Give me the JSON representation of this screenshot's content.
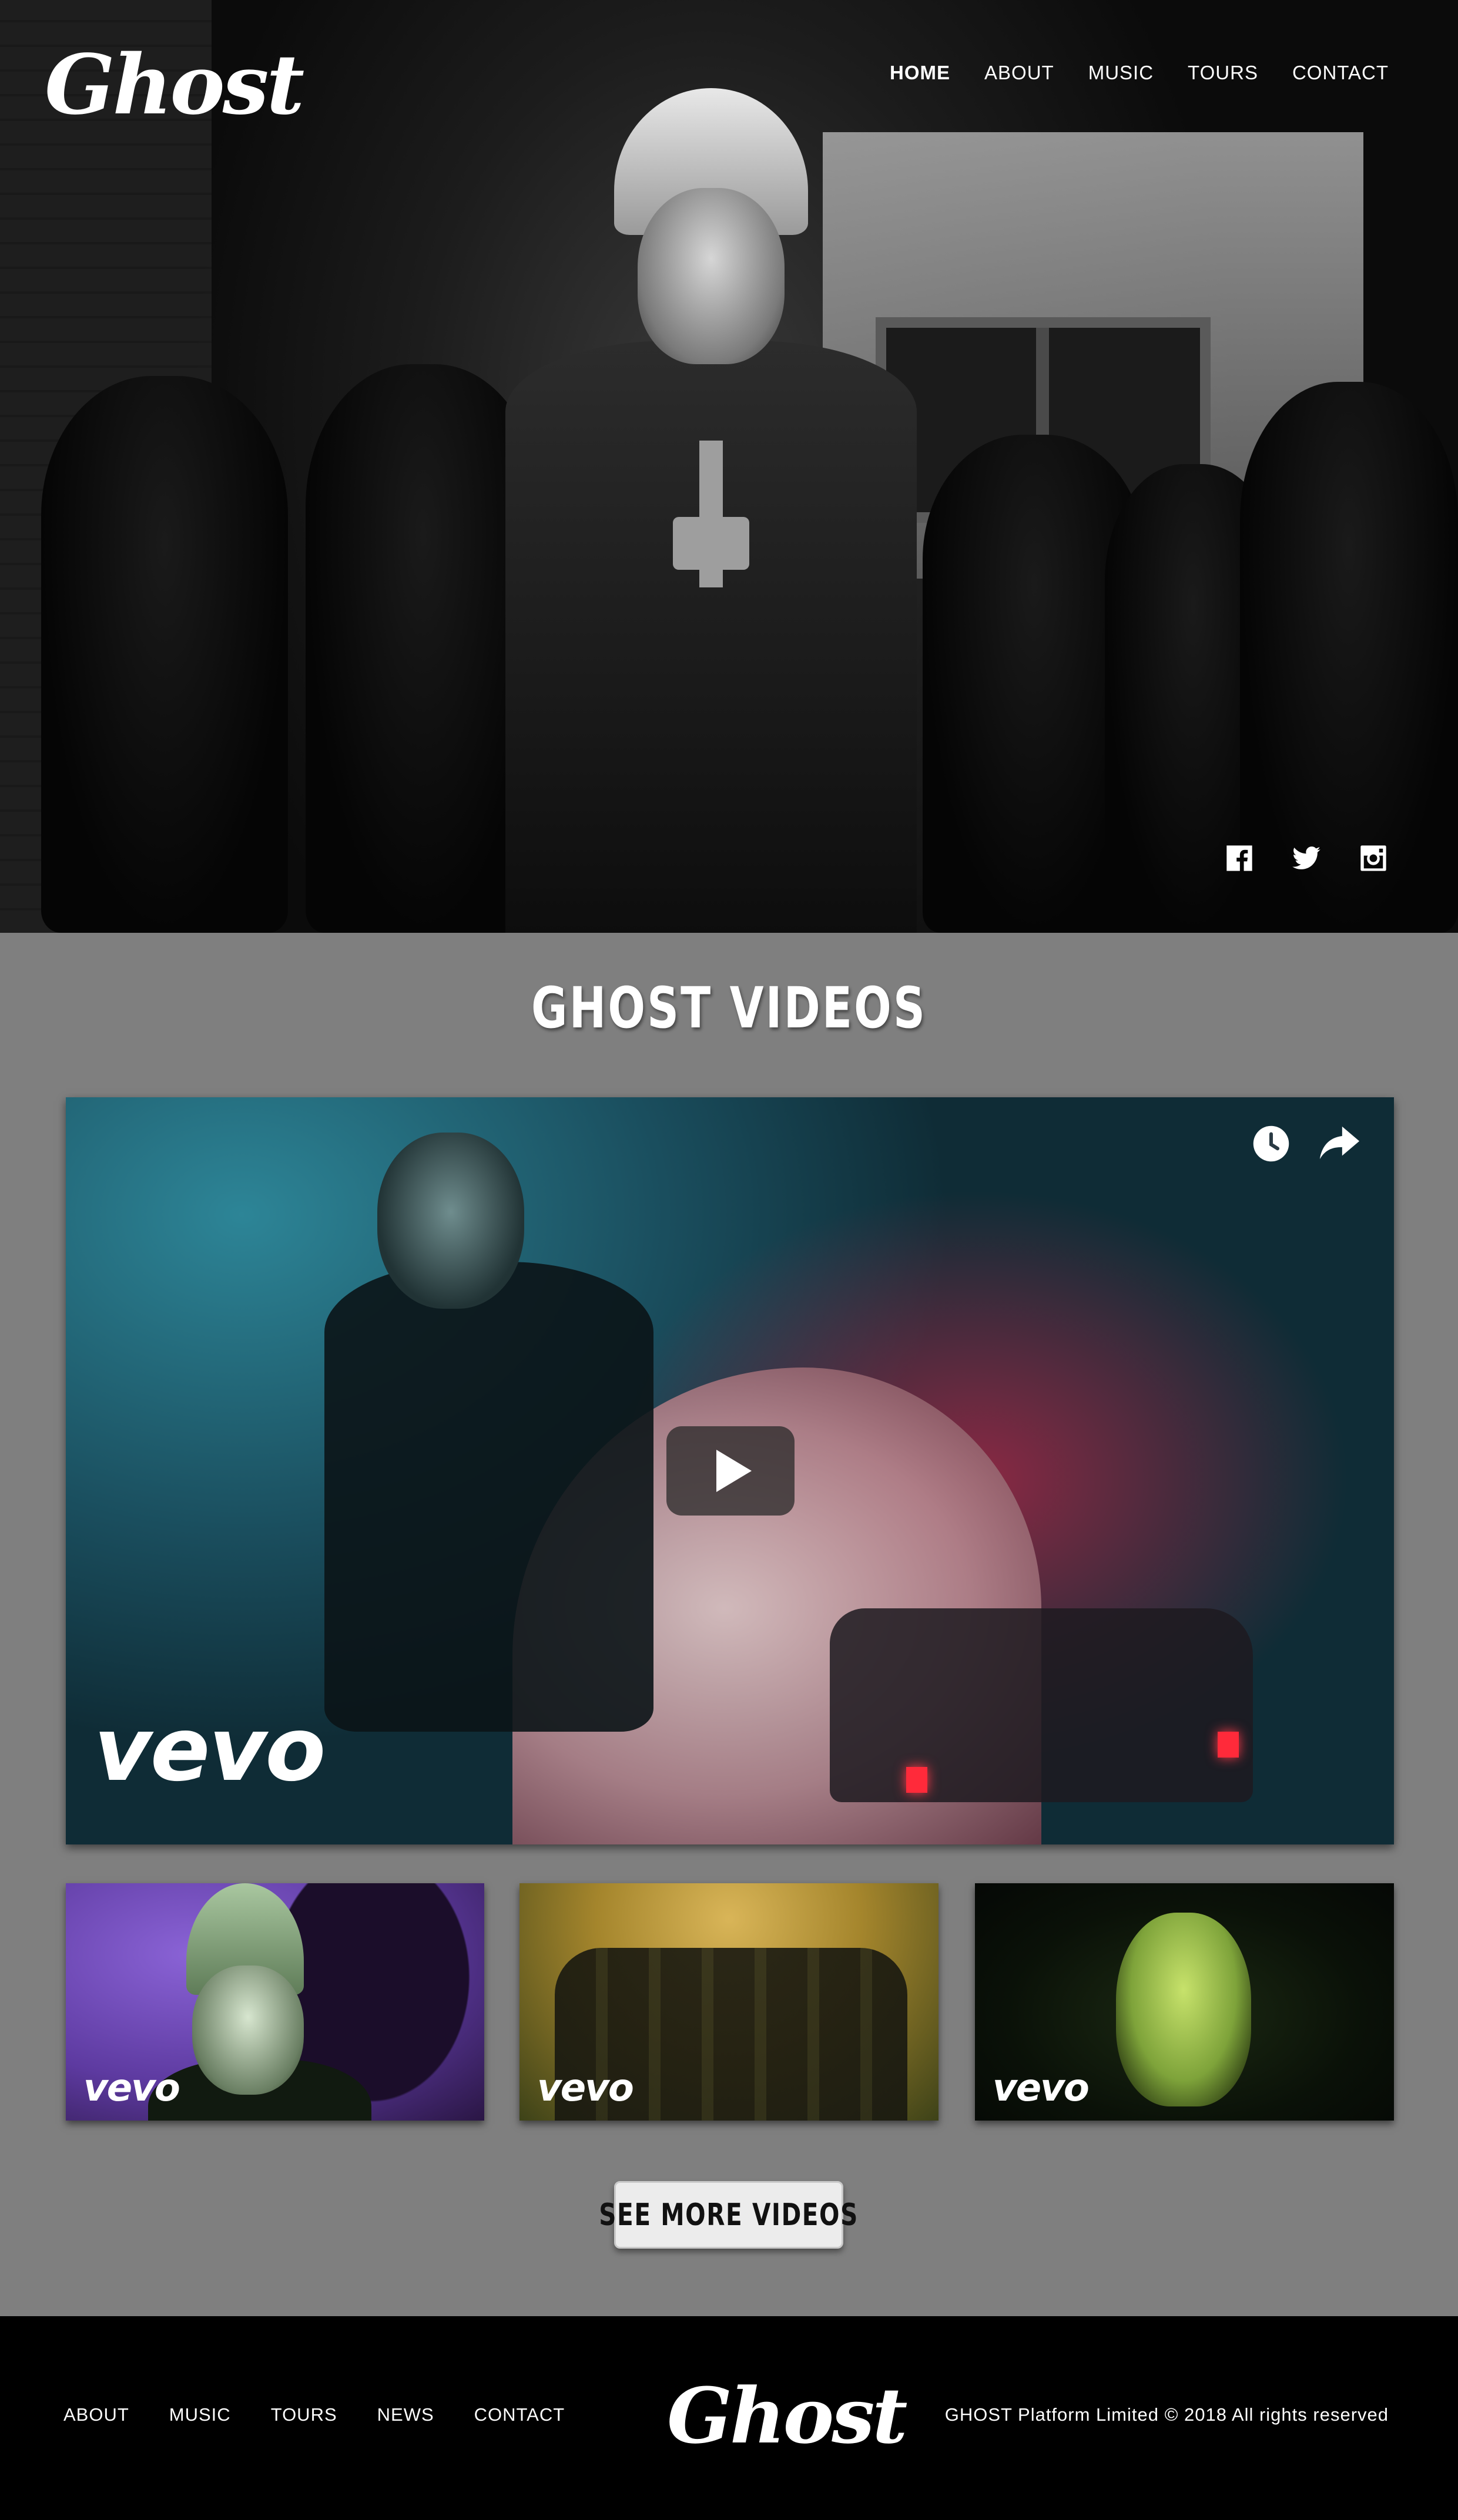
{
  "header": {
    "logo_text": "Ghost",
    "nav": [
      {
        "label": "HOME",
        "active": true
      },
      {
        "label": "ABOUT",
        "active": false
      },
      {
        "label": "MUSIC",
        "active": false
      },
      {
        "label": "TOURS",
        "active": false
      },
      {
        "label": "CONTACT",
        "active": false
      }
    ],
    "social_icons": [
      "facebook-icon",
      "twitter-icon",
      "instagram-icon"
    ]
  },
  "videos": {
    "title": "GHOST VIDEOS",
    "main_video": {
      "watermark": "vevo",
      "icons": [
        "clock-icon",
        "share-icon",
        "play-icon"
      ]
    },
    "thumbnails": [
      {
        "watermark": "vevo"
      },
      {
        "watermark": "vevo"
      },
      {
        "watermark": "vevo"
      }
    ],
    "see_more_label": "SEE MORE VIDEOS"
  },
  "footer": {
    "nav": [
      "ABOUT",
      "MUSIC",
      "TOURS",
      "NEWS",
      "CONTACT"
    ],
    "logo_text": "Ghost",
    "copyright": "GHOST Platform Limited © 2018 All rights reserved"
  },
  "colors": {
    "page_bg": "#7f7f7f",
    "footer_bg": "#000000",
    "text": "#ffffff",
    "button_bg": "#ececec"
  }
}
